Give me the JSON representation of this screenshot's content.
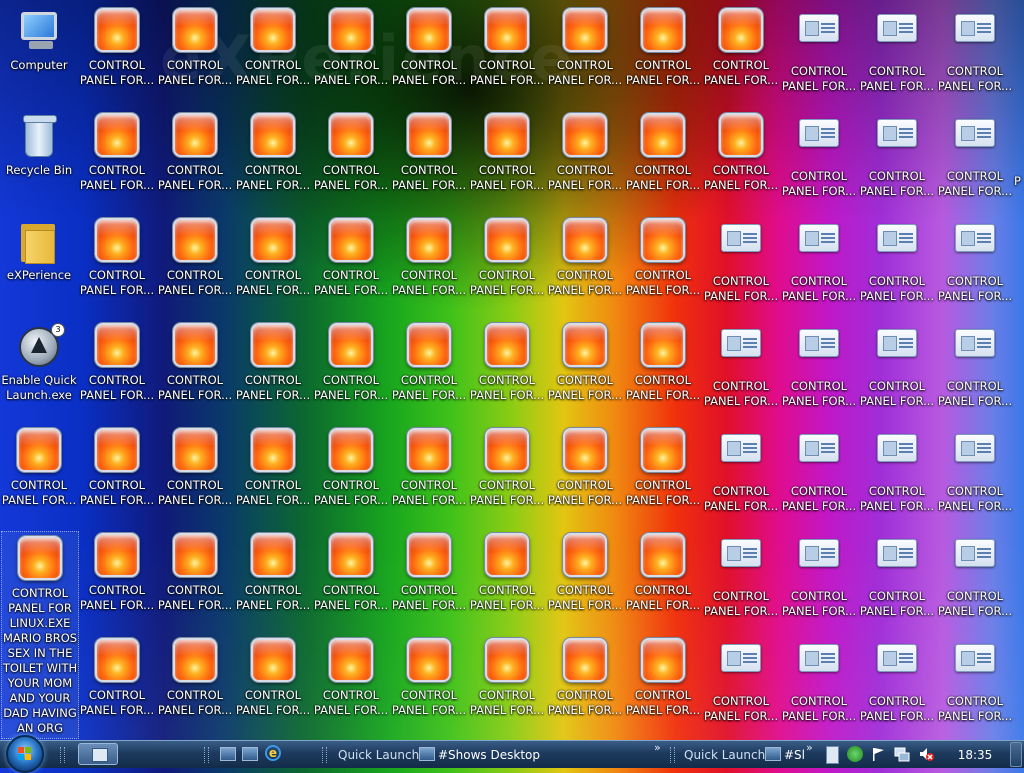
{
  "watermark": "eXPerience",
  "desktop": {
    "system_icons": [
      {
        "label": "Computer",
        "icon": "computer-icon"
      },
      {
        "label": "Recycle Bin",
        "icon": "recycle-bin-icon"
      },
      {
        "label": "eXPerience",
        "icon": "folder-icon"
      },
      {
        "label": "Enable Quick\nLaunch.exe",
        "icon": "app-launcher-icon"
      },
      {
        "label": "CONTROL\nPANEL FOR...",
        "icon": "flower-tile-icon"
      },
      {
        "label": "CONTROL\nPANEL FOR\nLINUX.EXE\nMARIO BROS\nSEX IN THE\nTOILET WITH\nYOUR MOM\nAND YOUR\nDAD HAVING\nAN ORG",
        "icon": "flower-tile-icon",
        "selected": true
      }
    ],
    "grid_label": "CONTROL\nPANEL FOR...",
    "rows": [
      [
        "flower",
        "flower",
        "flower",
        "flower",
        "flower",
        "flower",
        "flower",
        "flower",
        "flower",
        "card",
        "card",
        "card"
      ],
      [
        "flower",
        "flower",
        "flower",
        "flower",
        "flower",
        "flower",
        "flower",
        "flower",
        "flower",
        "card",
        "card",
        "card"
      ],
      [
        "flower",
        "flower",
        "flower",
        "flower",
        "flower",
        "flower",
        "flower",
        "flower",
        "card",
        "card",
        "card",
        "card"
      ],
      [
        "flower",
        "flower",
        "flower",
        "flower",
        "flower",
        "flower",
        "flower",
        "flower",
        "card",
        "card",
        "card",
        "card"
      ],
      [
        "flower",
        "flower",
        "flower",
        "flower",
        "flower",
        "flower",
        "flower",
        "flower",
        "card",
        "card",
        "card",
        "card"
      ],
      [
        "flower",
        "flower",
        "flower",
        "flower",
        "flower",
        "flower",
        "flower",
        "flower",
        "card",
        "card",
        "card",
        "card"
      ],
      [
        "flower",
        "flower",
        "flower",
        "flower",
        "flower",
        "flower",
        "flower",
        "flower",
        "card",
        "card",
        "card",
        "card"
      ]
    ],
    "edge_partial_label": "P"
  },
  "taskbar": {
    "quick_launch_1": "Quick Launch",
    "shows_desktop": "#Shows Desktop",
    "quick_launch_2": "Quick Launch",
    "shows_desktop_short": "#Sl",
    "clock": "18:35",
    "chevron": "»"
  }
}
